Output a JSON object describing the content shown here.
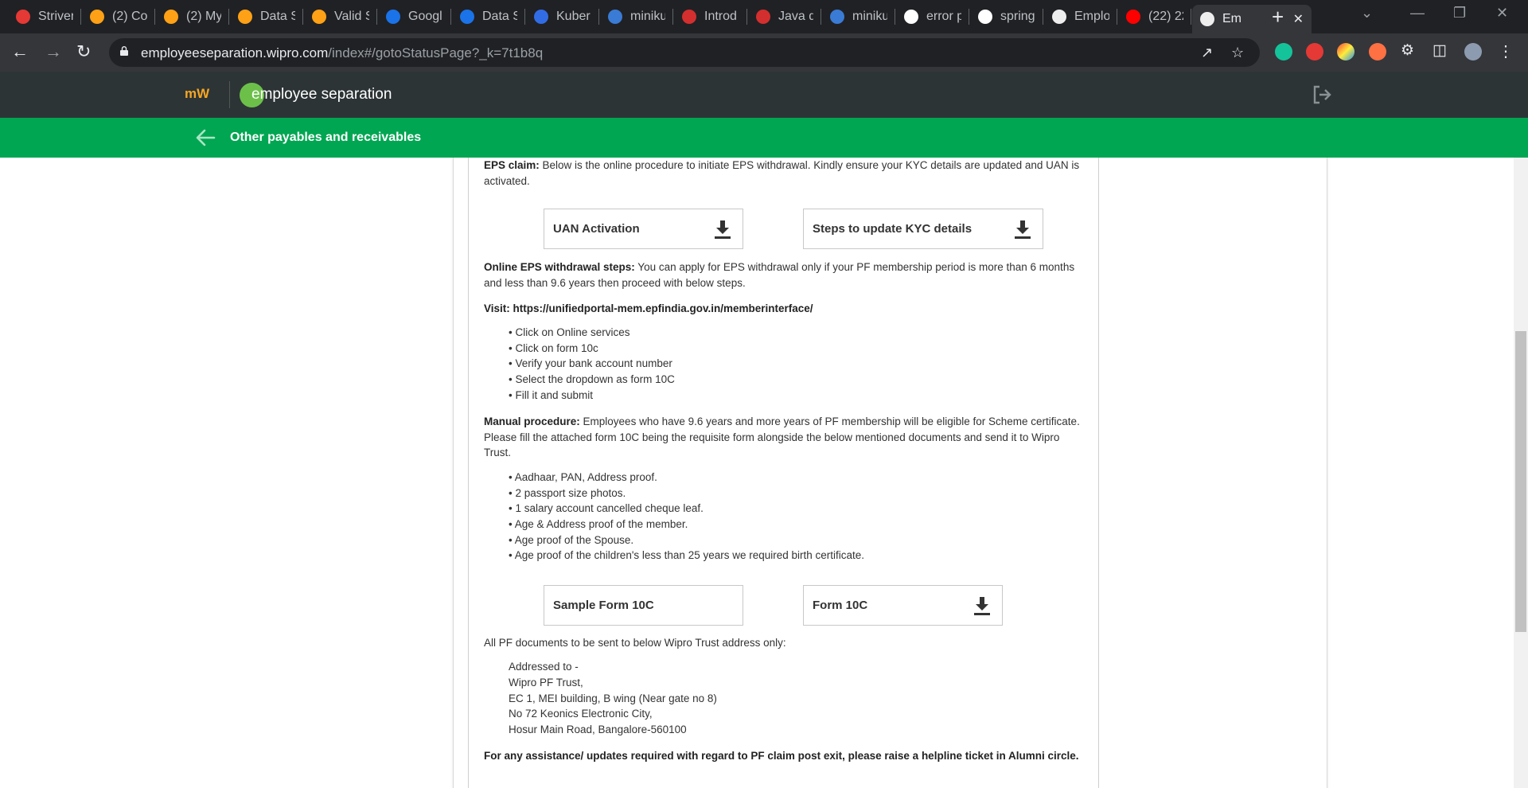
{
  "browser": {
    "tabs": [
      {
        "title": "Striver",
        "icon": "tuf-icon",
        "color": "#e53935"
      },
      {
        "title": "(2) Co",
        "icon": "leetcode-icon",
        "color": "#ffa116"
      },
      {
        "title": "(2) My",
        "icon": "leetcode-icon",
        "color": "#ffa116"
      },
      {
        "title": "Data S",
        "icon": "leetcode-icon",
        "color": "#ffa116"
      },
      {
        "title": "Valid S",
        "icon": "leetcode-icon",
        "color": "#ffa116"
      },
      {
        "title": "Googl",
        "icon": "at-icon",
        "color": "#1a73e8"
      },
      {
        "title": "Data S",
        "icon": "at-icon",
        "color": "#1a73e8"
      },
      {
        "title": "Kuber",
        "icon": "kubernetes-icon",
        "color": "#326ce5"
      },
      {
        "title": "miniku",
        "icon": "minikube-icon",
        "color": "#3a7bd5"
      },
      {
        "title": "Introd",
        "icon": "slide-icon",
        "color": "#d32f2f"
      },
      {
        "title": "Java d",
        "icon": "slide-icon",
        "color": "#d32f2f"
      },
      {
        "title": "miniku",
        "icon": "minikube-icon",
        "color": "#3a7bd5"
      },
      {
        "title": "error p",
        "icon": "github-icon",
        "color": "#ffffff"
      },
      {
        "title": "spring",
        "icon": "github-icon",
        "color": "#ffffff"
      },
      {
        "title": "Emplo",
        "icon": "wipro-icon",
        "color": "#eeeeee"
      },
      {
        "title": "(22) 22",
        "icon": "youtube-icon",
        "color": "#ff0000"
      },
      {
        "title": "Em",
        "icon": "wipro-icon",
        "color": "#eeeeee",
        "active": true
      }
    ],
    "url_host": "employeeseparation.wipro.com",
    "url_path": "/index#/gotoStatusPage?_k=7t1b8q"
  },
  "header": {
    "logo": "mW",
    "app_title": "employee separation"
  },
  "subheader": {
    "title": "Other payables and receivables"
  },
  "content": {
    "eps_claim_label": "EPS claim:",
    "eps_claim_text": " Below is the online procedure to initiate EPS withdrawal. Kindly ensure your KYC details are updated and UAN is activated.",
    "uan_button": "UAN Activation",
    "kyc_button": "Steps to update KYC details",
    "online_label": "Online EPS withdrawal steps:",
    "online_text": " You can apply for EPS withdrawal only if your PF membership period is more than 6 months and less than 9.6 years then proceed with below steps.",
    "visit_line": "Visit: https://unifiedportal-mem.epfindia.gov.in/memberinterface/",
    "online_steps": [
      "• Click on Online services",
      "• Click on form 10c",
      "• Verify your bank account number",
      "• Select the dropdown as form 10C",
      "• Fill it and submit"
    ],
    "manual_label": "Manual procedure:",
    "manual_text": " Employees who have 9.6 years and more years of PF membership will be eligible for Scheme certificate. Please fill the attached form 10C being the requisite form alongside the below mentioned documents and send it to Wipro Trust.",
    "manual_docs": [
      "• Aadhaar, PAN, Address proof.",
      "• 2 passport size photos.",
      "• 1 salary account cancelled cheque leaf.",
      "• Age & Address proof of the member.",
      "• Age proof of the Spouse.",
      "• Age proof of the children's less than 25 years we required birth certificate."
    ],
    "sample_form_button": "Sample Form 10C",
    "form_10c_button": "Form 10C",
    "address_intro": "All PF documents to be sent to below Wipro Trust address only:",
    "address_lines": [
      "Addressed to -",
      "Wipro PF Trust,",
      "EC 1, MEI building, B wing (Near gate no 8)",
      "No 72 Keonics Electronic City,",
      "Hosur Main Road, Bangalore-560100"
    ],
    "assistance_text": "For any assistance/ updates required with regard to PF claim post exit, please raise a helpline ticket in Alumni circle."
  }
}
